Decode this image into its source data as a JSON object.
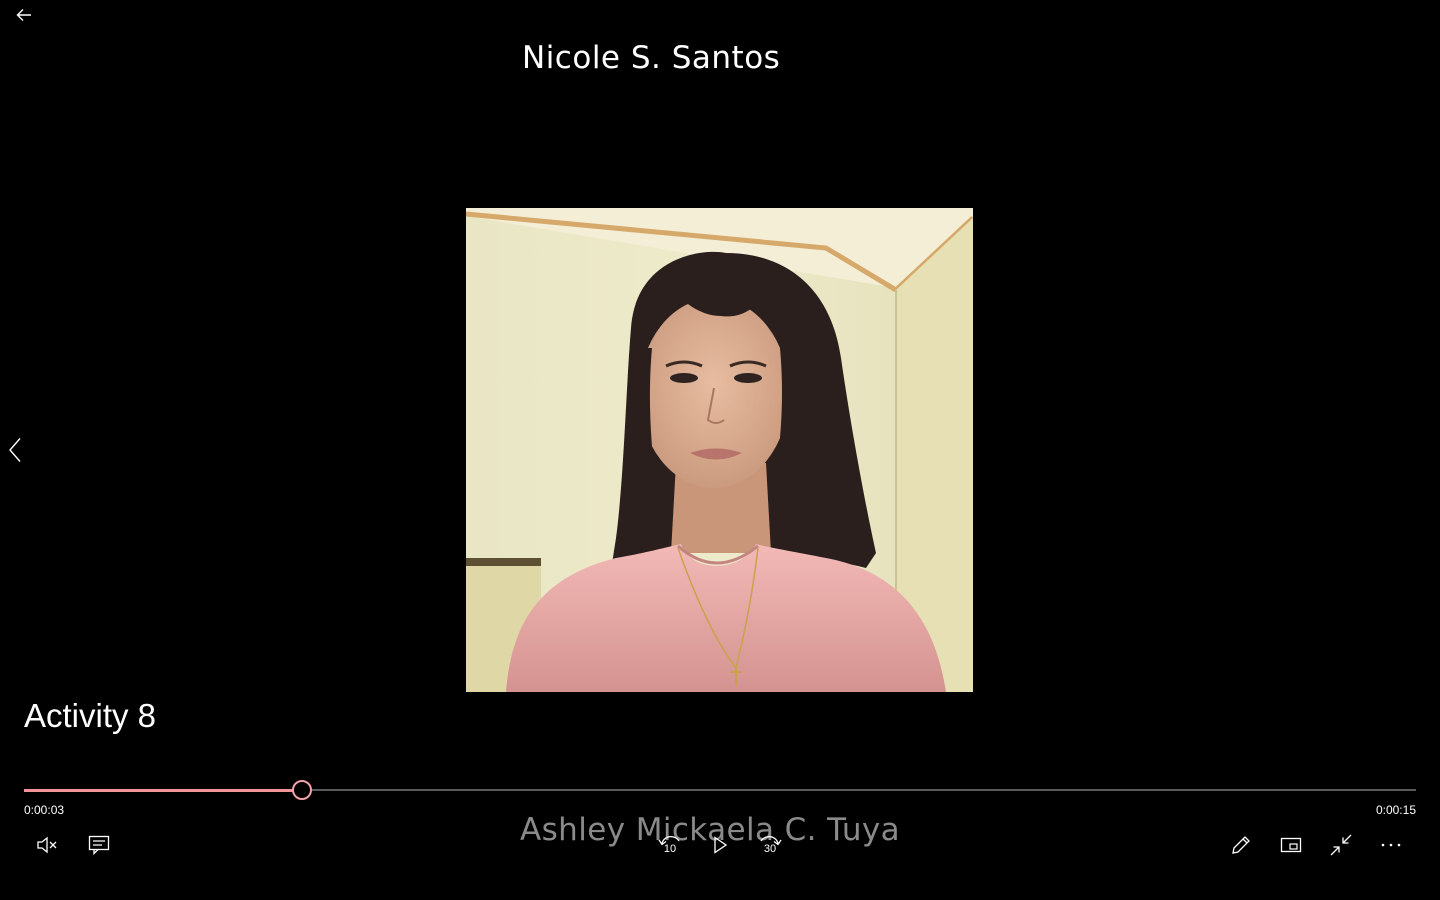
{
  "header": {
    "title": "Nicole S. Santos"
  },
  "caption": {
    "activity": "Activity 8",
    "author": "Ashley Mickaela C. Tuya"
  },
  "playback": {
    "current_time": "0:00:03",
    "total_time": "0:00:15",
    "progress": 0.2,
    "skip_back_seconds": "10",
    "skip_forward_seconds": "30",
    "muted": true,
    "playing": false
  },
  "colors": {
    "accent": "#f0949a",
    "background": "#000000"
  },
  "icons": {
    "back": "arrow-left-icon",
    "previous": "chevron-left-icon",
    "mute": "volume-muted-icon",
    "subtitles": "captions-icon",
    "skip_back": "rewind-10-icon",
    "play": "play-icon",
    "skip_forward": "forward-30-icon",
    "edit": "pencil-icon",
    "mini_player": "picture-in-picture-icon",
    "exit_fullscreen": "collapse-icon",
    "more": "ellipsis-icon"
  }
}
